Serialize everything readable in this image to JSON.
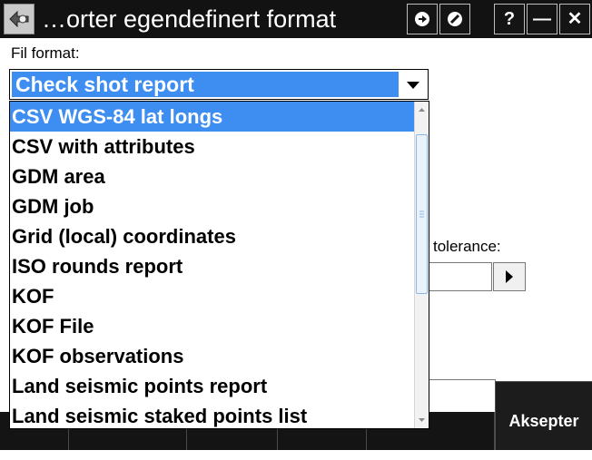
{
  "window": {
    "title": "…orter egendefinert format",
    "help_label": "?",
    "minimize_label": "—",
    "close_label": "✕"
  },
  "form": {
    "file_format_label": "Fil format:",
    "file_format_value": "Check shot report",
    "tolerance_label": "tolerance:"
  },
  "dropdown": {
    "options": [
      "CSV WGS-84 lat longs",
      "CSV with attributes",
      "GDM area",
      "GDM job",
      "Grid (local) coordinates",
      "ISO rounds report",
      "KOF",
      "KOF File",
      "KOF observations",
      "Land seismic points report",
      "Land seismic staked points list"
    ],
    "highlighted_index": 0
  },
  "bottom": {
    "accept_label": "Aksepter"
  },
  "colors": {
    "selection": "#3d8ef0",
    "titlebar": "#121212"
  }
}
